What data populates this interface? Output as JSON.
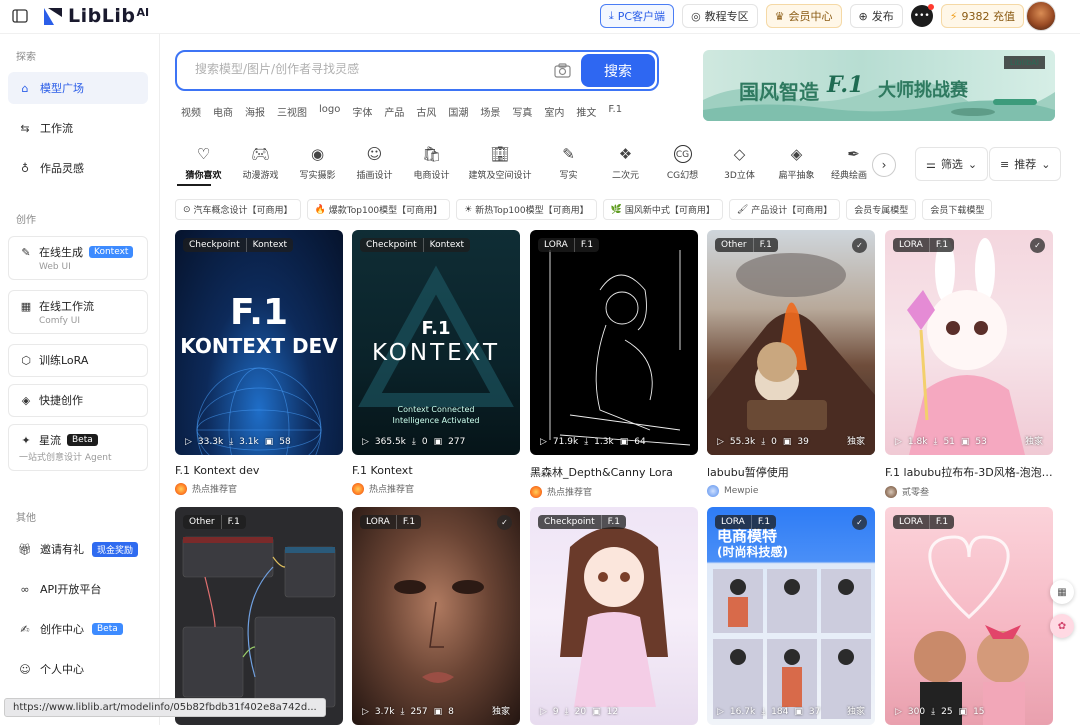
{
  "brand": {
    "logo_text": "LibLib",
    "logo_suffix": "AI"
  },
  "topbar": {
    "pc_client": "PC客户端",
    "tutorial": "教程专区",
    "vip": "会员中心",
    "publish": "发布",
    "credits": "9382 充值"
  },
  "sidebar": {
    "section_explore": "探索",
    "section_create": "创作",
    "section_other": "其他",
    "items": [
      {
        "label": "模型广场"
      },
      {
        "label": "工作流"
      },
      {
        "label": "作品灵感"
      }
    ],
    "create_cards": [
      {
        "label": "在线生成",
        "badge": "Kontext",
        "sub": "Web UI"
      },
      {
        "label": "在线工作流",
        "sub": "Comfy UI"
      }
    ],
    "create_items": [
      {
        "label": "训练LoRA"
      },
      {
        "label": "快捷创作"
      }
    ],
    "star": {
      "label": "星流",
      "badge": "Beta",
      "sub": "一站式创意设计 Agent"
    },
    "other_items": [
      {
        "label": "邀请有礼",
        "badge": "现金奖励"
      },
      {
        "label": "API开放平台"
      },
      {
        "label": "创作中心",
        "badge": "Beta"
      },
      {
        "label": "个人中心"
      }
    ]
  },
  "search": {
    "placeholder": "搜索模型/图片/创作者寻找灵感",
    "button": "搜索",
    "hot_tags": [
      "视频",
      "电商",
      "海报",
      "三视图",
      "logo",
      "字体",
      "产品",
      "古风",
      "国潮",
      "场景",
      "写真",
      "室内",
      "推文",
      "F.1"
    ]
  },
  "banner": {
    "t1": "国风智造",
    "t2": "F.1",
    "t3": "大师挑战赛",
    "brand": "LiblibAI"
  },
  "categories": [
    "猜你喜欢",
    "动漫游戏",
    "写实摄影",
    "插画设计",
    "电商设计",
    "建筑及空间设计",
    "写实",
    "二次元",
    "CG幻想",
    "3D立体",
    "扁平抽象",
    "经典绘画风",
    "手绘"
  ],
  "filters": {
    "filter": "筛选",
    "sort": "推荐"
  },
  "chips": [
    {
      "icon": "⊙",
      "label": "汽车概念设计【可商用】"
    },
    {
      "icon": "🔥",
      "label": "爆款Top100模型【可商用】"
    },
    {
      "icon": "☀",
      "label": "新热Top100模型【可商用】"
    },
    {
      "icon": "🌿",
      "label": "国风新中式【可商用】"
    },
    {
      "icon": "🖌",
      "label": "产品设计【可商用】"
    },
    {
      "icon": "",
      "label": "会员专属模型"
    },
    {
      "icon": "",
      "label": "会员下载模型"
    }
  ],
  "cards": [
    {
      "tags": [
        "Checkpoint",
        "Kontext"
      ],
      "line1": "F.1",
      "line2": "KONTEXT DEV",
      "runs": "33.3k",
      "downloads": "3.1k",
      "images": "58",
      "exclusive": "",
      "title": "F.1 Kontext dev",
      "author": "热点推荐官"
    },
    {
      "tags": [
        "Checkpoint",
        "Kontext"
      ],
      "line1": "F.1",
      "line2": "KONTEXT",
      "line3": "Context Connected",
      "line4": "Intelligence Activated",
      "runs": "365.5k",
      "downloads": "0",
      "images": "277",
      "exclusive": "",
      "title": "F.1 Kontext",
      "author": "热点推荐官"
    },
    {
      "tags": [
        "LORA",
        "F.1"
      ],
      "runs": "71.9k",
      "downloads": "1.3k",
      "images": "64",
      "exclusive": "",
      "title": "黑森林_Depth&Canny Lora",
      "author": "热点推荐官"
    },
    {
      "tags": [
        "Other",
        "F.1"
      ],
      "runs": "55.3k",
      "downloads": "0",
      "images": "39",
      "exclusive": "独家",
      "title": "labubu暂停使用",
      "author": "Mewpie"
    },
    {
      "tags": [
        "LORA",
        "F.1"
      ],
      "runs": "1.8k",
      "downloads": "51",
      "images": "53",
      "exclusive": "独家",
      "title": "F.1 labubu拉布布-3D风格-泡泡玛...",
      "author": "贰零叁"
    },
    {
      "tags": [
        "Other",
        "F.1"
      ],
      "runs": "0",
      "downloads": "6.6k",
      "images": "0",
      "exclusive": ""
    },
    {
      "tags": [
        "LORA",
        "F.1"
      ],
      "runs": "3.7k",
      "downloads": "257",
      "images": "8",
      "exclusive": "独家"
    },
    {
      "tags": [
        "Checkpoint",
        "F.1"
      ],
      "runs": "9",
      "downloads": "20",
      "images": "12",
      "exclusive": ""
    },
    {
      "tags": [
        "LORA",
        "F.1"
      ],
      "line1": "电商模特",
      "line2": "(时尚科技感)",
      "runs": "16.7k",
      "downloads": "184",
      "images": "37",
      "exclusive": "独家"
    },
    {
      "tags": [
        "LORA",
        "F.1"
      ],
      "runs": "300",
      "downloads": "25",
      "images": "15",
      "exclusive": ""
    }
  ],
  "status_url": "https://www.liblib.art/modelinfo/05b82fbdb31f402e8a742d..."
}
